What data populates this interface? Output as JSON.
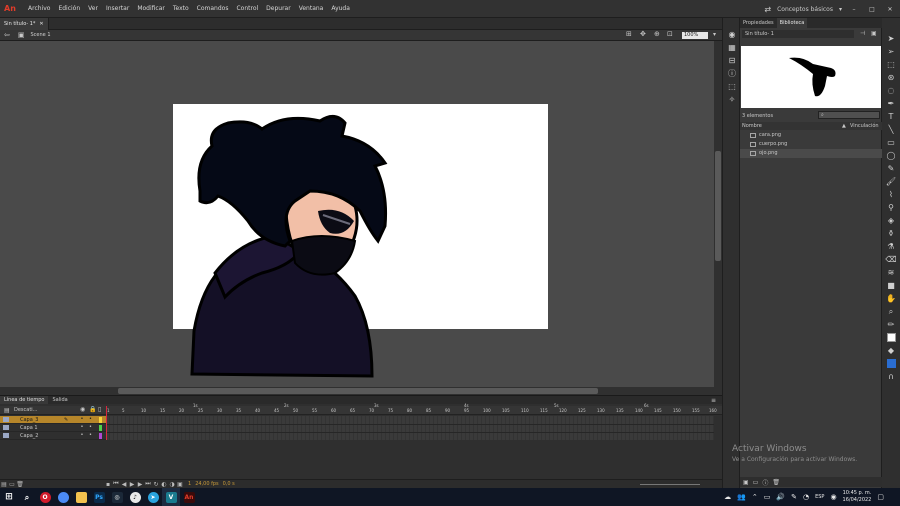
{
  "app": {
    "logo": "An",
    "workspace": "Conceptos básicos"
  },
  "menu": [
    "Archivo",
    "Edición",
    "Ver",
    "Insertar",
    "Modificar",
    "Texto",
    "Comandos",
    "Control",
    "Depurar",
    "Ventana",
    "Ayuda"
  ],
  "document": {
    "tab": "Sin título- 1*",
    "scene": "Scene 1",
    "zoom": "100%"
  },
  "timeline": {
    "tabs": [
      "Línea de tiempo",
      "Salida"
    ],
    "header_label": "Descati...",
    "ruler_frames": [
      "1",
      "5",
      "10",
      "15",
      "20",
      "25",
      "30",
      "35",
      "40",
      "45",
      "50",
      "55",
      "60",
      "65",
      "70",
      "75",
      "80",
      "85",
      "90",
      "95",
      "100",
      "105",
      "110",
      "115",
      "120",
      "125",
      "130",
      "135",
      "140",
      "145",
      "150",
      "155",
      "160"
    ],
    "ruler_seconds": [
      "1s",
      "2s",
      "3s",
      "4s",
      "5s",
      "6s"
    ],
    "layers": [
      {
        "name": "Capa_3",
        "selected": true,
        "color": "#f5d23b"
      },
      {
        "name": "Capa 1",
        "selected": false,
        "color": "#4fd34a"
      },
      {
        "name": "Capa_2",
        "selected": false,
        "color": "#b04ad3"
      }
    ],
    "fps": "24,00 fps",
    "current_frame": "1",
    "time": "0,0 s"
  },
  "library": {
    "tabs": [
      "Propiedades",
      "Biblioteca"
    ],
    "document": "Sin título- 1",
    "count": "3 elementos",
    "col_name": "Nombre",
    "col_vis": "Vinculación",
    "items": [
      {
        "name": "cara.png",
        "selected": false
      },
      {
        "name": "cuerpo.png",
        "selected": false
      },
      {
        "name": "ojo.png",
        "selected": true
      }
    ]
  },
  "watermark": {
    "title": "Activar Windows",
    "subtitle": "Ve a Configuración para activar Windows."
  },
  "taskbar": {
    "lang": "ESP",
    "time": "10:45 p. m.",
    "date": "16/04/2022"
  }
}
